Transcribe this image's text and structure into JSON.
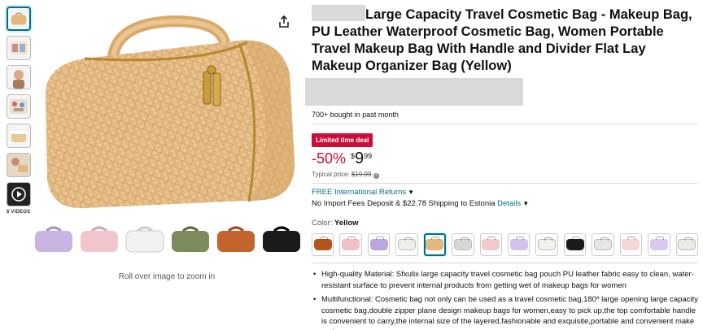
{
  "gallery": {
    "thumbnails": [
      "bag-yellow",
      "bag-open",
      "bag-model",
      "bag-contents",
      "bag-detail",
      "bag-lifestyle"
    ],
    "video_count_label": "6 VIDEOS",
    "zoom_hint": "Roll over image to zoom in",
    "image_swatches": [
      "#c9b5e3",
      "#f0c6cc",
      "#f2f2f0",
      "#7c8a5c",
      "#c2642c",
      "#1a1a1a"
    ]
  },
  "product": {
    "title": "Large Capacity Travel Cosmetic Bag - Makeup Bag, PU Leather Waterproof Cosmetic Bag, Women Portable Travel Makeup Bag With Handle and Divider Flat Lay Makeup Organizer Bag (Yellow)",
    "bought": "700+ bought in past month",
    "deal_badge": "Limited time deal",
    "discount": "-50%",
    "price_symbol": "$",
    "price_whole": "9",
    "price_fraction": "99",
    "typical_label": "Typical price:",
    "typical_price": "$19.99",
    "returns": "FREE International Returns",
    "shipping_text": "No Import Fees Deposit & $22.78 Shipping to Estonia",
    "shipping_details": "Details",
    "color_label": "Color:",
    "color_value": "Yellow",
    "color_swatches": [
      "#b5541d",
      "#f0c0c6",
      "#bca7dc",
      "#eeeeea",
      "#e3b77f",
      "#d7d7d7",
      "#f2c9cc",
      "#d3c2ea",
      "#f2f2ee",
      "#1b1b1b",
      "#e6e6e6",
      "#f4d6d6",
      "#d8c8ee",
      "#e9ece4"
    ],
    "selected_swatch_index": 4,
    "bullets": [
      "High-quality Material: Sfxulix large capacity travel cosmetic bag pouch PU leather fabric easy to clean, water-resistant surface to prevent internal products from getting wet of makeup bags for women",
      "Multifunctional: Cosmetic bag not only can be used as a travel cosmetic bag,180º large opening large capacity cosmetic bag,double zipper plane design makeup bags for women,easy to pick up,the top comfortable handle is convenient to carry,the internal size of the layered,fashionable and exquisite,portable and convenient make up bag"
    ]
  },
  "colors": {
    "link": "#007185",
    "deal": "#cc0c39",
    "bag": "#e3b77f"
  }
}
